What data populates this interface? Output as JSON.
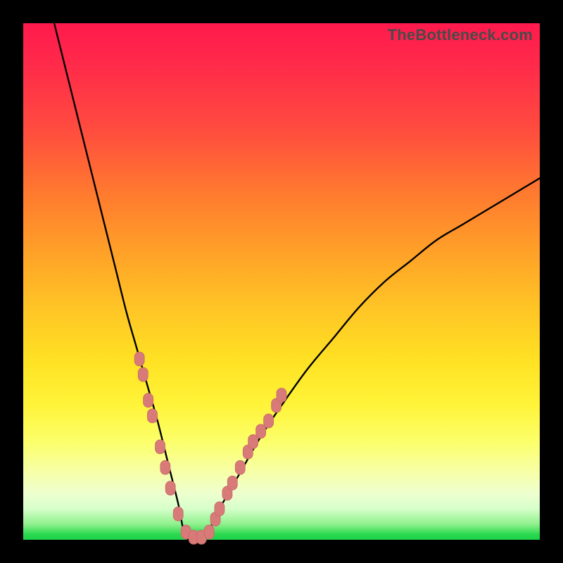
{
  "watermark": "TheBottleneck.com",
  "colors": {
    "curve_stroke": "#000000",
    "marker_fill": "#d77a78",
    "marker_stroke": "#c76a68",
    "frame_bg": "#000000"
  },
  "chart_data": {
    "type": "line",
    "title": "",
    "xlabel": "",
    "ylabel": "",
    "xlim": [
      0,
      100
    ],
    "ylim": [
      0,
      100
    ],
    "grid": false,
    "legend": false,
    "series": [
      {
        "name": "bottleneck-curve",
        "x": [
          6,
          8,
          10,
          12,
          14,
          16,
          18,
          20,
          22,
          24,
          26,
          28,
          30,
          31,
          32,
          34,
          36,
          38,
          42,
          46,
          50,
          55,
          60,
          65,
          70,
          75,
          80,
          85,
          90,
          95,
          100
        ],
        "y": [
          100,
          92,
          84,
          76,
          68,
          60,
          52,
          44,
          37,
          30,
          23,
          15,
          7,
          2,
          0,
          0,
          2,
          6,
          13,
          20,
          26,
          33,
          39,
          45,
          50,
          54,
          58,
          61,
          64,
          67,
          70
        ]
      }
    ],
    "markers": [
      {
        "x": 22.5,
        "y": 35
      },
      {
        "x": 23.2,
        "y": 32
      },
      {
        "x": 24.2,
        "y": 27
      },
      {
        "x": 25.0,
        "y": 24
      },
      {
        "x": 26.5,
        "y": 18
      },
      {
        "x": 27.5,
        "y": 14
      },
      {
        "x": 28.5,
        "y": 10
      },
      {
        "x": 30.0,
        "y": 5
      },
      {
        "x": 31.5,
        "y": 1.5
      },
      {
        "x": 33.0,
        "y": 0.5
      },
      {
        "x": 34.5,
        "y": 0.5
      },
      {
        "x": 36.0,
        "y": 1.5
      },
      {
        "x": 37.2,
        "y": 4
      },
      {
        "x": 38.0,
        "y": 6
      },
      {
        "x": 39.5,
        "y": 9
      },
      {
        "x": 40.5,
        "y": 11
      },
      {
        "x": 42.0,
        "y": 14
      },
      {
        "x": 43.5,
        "y": 17
      },
      {
        "x": 44.5,
        "y": 19
      },
      {
        "x": 46.0,
        "y": 21
      },
      {
        "x": 47.5,
        "y": 23
      },
      {
        "x": 49.0,
        "y": 26
      },
      {
        "x": 50.0,
        "y": 28
      }
    ]
  }
}
